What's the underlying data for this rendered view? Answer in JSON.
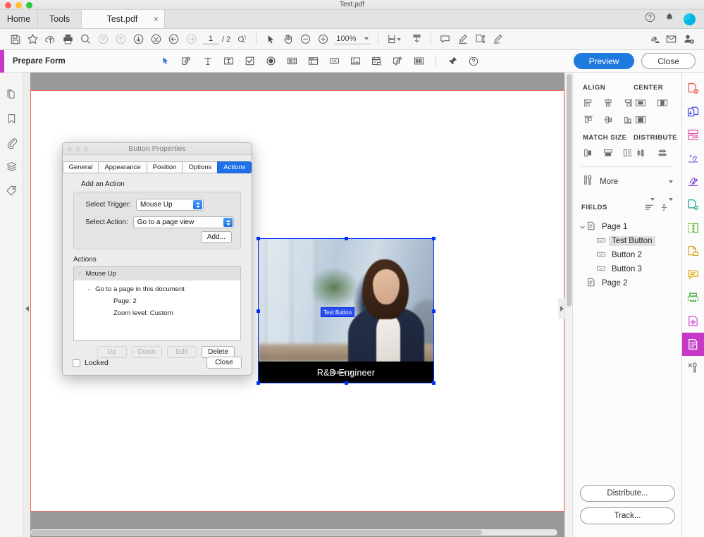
{
  "window": {
    "title": "Test.pdf"
  },
  "tabs": {
    "home": "Home",
    "tools": "Tools",
    "document": "Test.pdf",
    "close_glyph": "×"
  },
  "toolbar": {
    "icons": [
      {
        "name": "save-icon",
        "label": "Save"
      },
      {
        "name": "star-icon",
        "label": "Add to Favorites"
      },
      {
        "name": "cloud-upload-icon",
        "label": "Upload"
      },
      {
        "name": "print-icon",
        "label": "Print"
      },
      {
        "name": "search-icon",
        "label": "Find"
      },
      {
        "name": "first-page-icon",
        "label": "First Page"
      },
      {
        "name": "previous-page-icon",
        "label": "Previous Page"
      },
      {
        "name": "next-page-icon",
        "label": "Next Page"
      },
      {
        "name": "last-page-icon",
        "label": "Last Page"
      },
      {
        "name": "back-icon",
        "label": "Previous View"
      },
      {
        "name": "forward-icon",
        "label": "Next View"
      }
    ],
    "page_current": "1",
    "page_total": "/ 2",
    "select_tool": "select-icon",
    "hand_tool": "hand-icon",
    "zoom_out": "zoom-out-icon",
    "zoom_in": "zoom-in-icon",
    "zoom_level": "100%",
    "fit_page": "fit-page-icon",
    "scroll_mode": "page-scroll-icon",
    "comment": "comment-icon",
    "highlight": "highlight-icon",
    "pages": "organize-pages-icon",
    "sign": "sign-icon",
    "share_link": "share-link-icon",
    "email": "email-icon",
    "add_person": "add-person-icon"
  },
  "formbar": {
    "title": "Prepare Form",
    "tools": [
      {
        "name": "select-object-icon"
      },
      {
        "name": "add-field-icon"
      },
      {
        "name": "text-field-icon"
      },
      {
        "name": "text-box-icon"
      },
      {
        "name": "checkbox-field-icon"
      },
      {
        "name": "radio-button-field-icon"
      },
      {
        "name": "list-box-field-icon"
      },
      {
        "name": "dropdown-field-icon"
      },
      {
        "name": "button-field-icon"
      },
      {
        "name": "image-field-icon"
      },
      {
        "name": "date-field-icon"
      },
      {
        "name": "signature-field-icon"
      },
      {
        "name": "barcode-field-icon"
      }
    ],
    "pin": "pin-icon",
    "help": "help-icon",
    "preview_label": "Preview",
    "close_label": "Close",
    "accent_color": "#c738c7",
    "preview_color": "#1f7ae0"
  },
  "left_rail": [
    {
      "name": "page-thumbnails-icon"
    },
    {
      "name": "bookmarks-icon"
    },
    {
      "name": "attachments-icon"
    },
    {
      "name": "layers-icon"
    },
    {
      "name": "tags-icon"
    }
  ],
  "document": {
    "image_alt": "Businesswoman at desk in office",
    "black_bar_text": "R&D Engineer",
    "overlay_button_label": "Button_3",
    "selected_field_label": "Test Button",
    "selection_color": "#0033ff",
    "page_border_color": "#ef6a5e"
  },
  "right_panel": {
    "align": {
      "title": "ALIGN",
      "icons": [
        {
          "name": "align-left-icon"
        },
        {
          "name": "align-vertical-center-icon"
        },
        {
          "name": "align-right-icon"
        },
        {
          "name": "align-top-icon"
        },
        {
          "name": "align-horizontal-center-icon"
        },
        {
          "name": "align-bottom-icon"
        }
      ]
    },
    "center": {
      "title": "CENTER",
      "icons": [
        {
          "name": "center-horizontally-icon"
        },
        {
          "name": "center-vertically-icon"
        },
        {
          "name": "center-both-icon"
        }
      ]
    },
    "match_size": {
      "title": "MATCH SIZE",
      "icons": [
        {
          "name": "match-width-icon"
        },
        {
          "name": "match-height-icon"
        },
        {
          "name": "match-both-icon"
        }
      ]
    },
    "distribute": {
      "title": "DISTRIBUTE",
      "icons": [
        {
          "name": "distribute-vertically-icon"
        },
        {
          "name": "distribute-horizontally-icon"
        }
      ]
    },
    "more_label": "More",
    "fields_title": "FIELDS",
    "fields_sort_icon": "sort-order-icon",
    "fields_alpha_icon": "sort-alpha-icon",
    "tree": [
      {
        "label": "Page 1",
        "type": "page",
        "expanded": true,
        "depth": 0,
        "selected": false
      },
      {
        "label": "Test Button",
        "type": "field",
        "depth": 1,
        "selected": true
      },
      {
        "label": "Button 2",
        "type": "field",
        "depth": 1,
        "selected": false
      },
      {
        "label": "Button 3",
        "type": "field",
        "depth": 1,
        "selected": false
      },
      {
        "label": "Page 2",
        "type": "page",
        "expanded": false,
        "depth": 0,
        "selected": false
      }
    ],
    "distribute_button": "Distribute...",
    "track_button": "Track..."
  },
  "far_rail": [
    {
      "name": "create-pdf-icon",
      "color": "#e2574c"
    },
    {
      "name": "combine-files-icon",
      "color": "#4a4ae0"
    },
    {
      "name": "organize-pages-icon",
      "color": "#e0489c"
    },
    {
      "name": "fill-and-sign-icon",
      "color": "#7b5ce0"
    },
    {
      "name": "request-signatures-icon",
      "color": "#8a4ce0"
    },
    {
      "name": "edit-pdf-icon",
      "color": "#17a398"
    },
    {
      "name": "export-pdf-icon",
      "color": "#5bb62c"
    },
    {
      "name": "protect-icon",
      "color": "#d4a017"
    },
    {
      "name": "comment-icon",
      "color": "#e0a800"
    },
    {
      "name": "scan-ocr-icon",
      "color": "#3faf3f"
    },
    {
      "name": "enhance-scans-icon",
      "color": "#d04fd0"
    },
    {
      "name": "prepare-form-icon",
      "color": "#ffffff",
      "active": true
    },
    {
      "name": "more-tools-icon",
      "color": "#707070"
    }
  ],
  "dialog": {
    "title": "Button Properties",
    "tabs": [
      {
        "label": "General",
        "active": false
      },
      {
        "label": "Appearance",
        "active": false
      },
      {
        "label": "Position",
        "active": false
      },
      {
        "label": "Options",
        "active": false
      },
      {
        "label": "Actions",
        "active": true
      }
    ],
    "add_action_label": "Add an Action",
    "trigger_label": "Select Trigger:",
    "trigger_value": "Mouse Up",
    "action_label": "Select Action:",
    "action_value": "Go to a page view",
    "add_button": "Add...",
    "actions_label": "Actions",
    "actions_tree": {
      "trigger": "Mouse Up",
      "action": "Go to a page in this document",
      "details": [
        "Page: 2",
        "Zoom level: Custom"
      ]
    },
    "list_buttons": [
      {
        "label": "Up",
        "disabled": true
      },
      {
        "label": "Down",
        "disabled": true
      },
      {
        "label": "Edit",
        "disabled": true
      },
      {
        "label": "Delete",
        "disabled": false
      }
    ],
    "locked_label": "Locked",
    "locked_checked": false,
    "close_label": "Close",
    "accent_color": "#2071e8"
  }
}
